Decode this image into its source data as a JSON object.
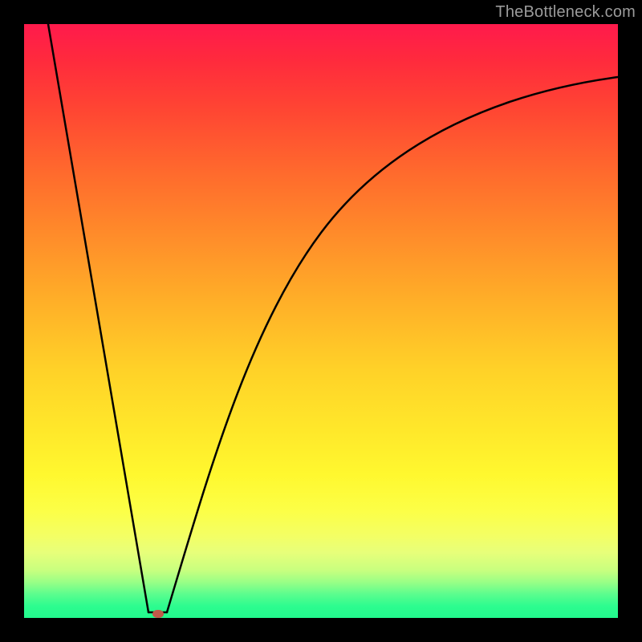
{
  "watermark": "TheBottleneck.com",
  "marker": {
    "x_pct": 22.5,
    "y_pct": 99.3,
    "color": "#c15a4a"
  },
  "chart_data": {
    "type": "line",
    "title": "",
    "xlabel": "",
    "ylabel": "",
    "xlim": [
      0,
      100
    ],
    "ylim": [
      0,
      100
    ],
    "grid": false,
    "legend": false,
    "annotations": [
      "TheBottleneck.com"
    ],
    "background_gradient": {
      "top_color": "#ff1a4c",
      "mid_color": "#ffe72a",
      "bottom_color": "#22f88d",
      "note": "color maps to y value: high=red, mid=yellow, low=green"
    },
    "series": [
      {
        "name": "left-segment",
        "x": [
          4,
          8,
          12,
          16,
          19,
          21
        ],
        "y": [
          100,
          77,
          54,
          31,
          13,
          1
        ]
      },
      {
        "name": "right-segment",
        "x": [
          24,
          26,
          28,
          31,
          34,
          38,
          42,
          46,
          51,
          56,
          62,
          68,
          74,
          80,
          86,
          92,
          98,
          100
        ],
        "y": [
          1,
          9,
          18,
          29,
          38,
          48,
          56,
          62,
          68,
          73,
          78,
          81,
          84,
          86,
          88,
          89,
          90,
          91
        ]
      }
    ],
    "marker_point": {
      "x": 22.5,
      "y": 0.7,
      "color": "#c15a4a"
    }
  }
}
